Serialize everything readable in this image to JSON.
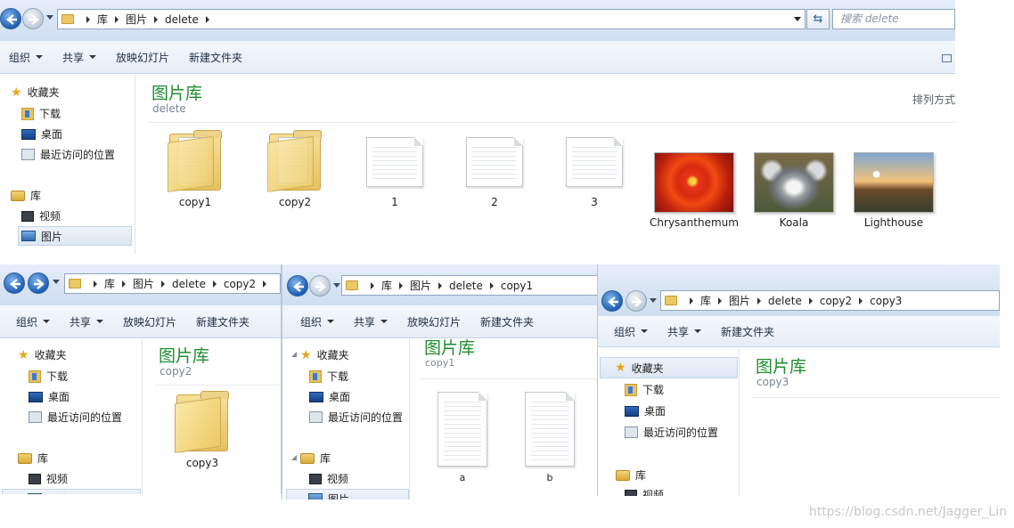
{
  "main": {
    "crumbs": [
      "库",
      "图片",
      "delete"
    ],
    "search_placeholder": "搜索 delete",
    "toolbar": [
      "组织",
      "共享",
      "放映幻灯片",
      "新建文件夹"
    ],
    "nav": {
      "favorites": "收藏夹",
      "downloads": "下载",
      "desktop": "桌面",
      "recent": "最近访问的位置",
      "libraries": "库",
      "videos": "视频",
      "pictures": "图片"
    },
    "title": "图片库",
    "subtitle": "delete",
    "arrange": "排列方式",
    "items": [
      {
        "label": "copy1",
        "kind": "folder"
      },
      {
        "label": "copy2",
        "kind": "folder"
      },
      {
        "label": "1",
        "kind": "document"
      },
      {
        "label": "2",
        "kind": "document"
      },
      {
        "label": "3",
        "kind": "document"
      },
      {
        "label": "Chrysanthemum",
        "kind": "photo"
      },
      {
        "label": "Koala",
        "kind": "photo"
      },
      {
        "label": "Lighthouse",
        "kind": "photo"
      }
    ]
  },
  "copy2": {
    "crumbs": [
      "库",
      "图片",
      "delete",
      "copy2"
    ],
    "toolbar": [
      "组织",
      "共享",
      "放映幻灯片",
      "新建文件夹"
    ],
    "nav": {
      "favorites": "收藏夹",
      "downloads": "下载",
      "desktop": "桌面",
      "recent": "最近访问的位置",
      "libraries": "库",
      "videos": "视频",
      "pictures": "图片"
    },
    "title": "图片库",
    "subtitle": "copy2",
    "items": [
      {
        "label": "copy3",
        "kind": "folder"
      }
    ]
  },
  "copy1": {
    "crumbs": [
      "库",
      "图片",
      "delete",
      "copy1"
    ],
    "toolbar": [
      "组织",
      "共享",
      "放映幻灯片",
      "新建文件夹"
    ],
    "nav": {
      "favorites": "收藏夹",
      "downloads": "下载",
      "desktop": "桌面",
      "recent": "最近访问的位置",
      "libraries": "库",
      "videos": "视频",
      "pictures": "图片"
    },
    "title": "图片库",
    "subtitle": "copy1",
    "items": [
      {
        "label": "a",
        "kind": "document"
      },
      {
        "label": "b",
        "kind": "document"
      }
    ]
  },
  "copy3": {
    "crumbs": [
      "库",
      "图片",
      "delete",
      "copy2",
      "copy3"
    ],
    "toolbar": [
      "组织",
      "共享",
      "新建文件夹"
    ],
    "nav": {
      "favorites": "收藏夹",
      "downloads": "下载",
      "desktop": "桌面",
      "recent": "最近访问的位置",
      "libraries": "库",
      "videos": "视频"
    },
    "title": "图片库",
    "subtitle": "copy3"
  },
  "watermark": "https://blog.csdn.net/Jagger_Lin"
}
